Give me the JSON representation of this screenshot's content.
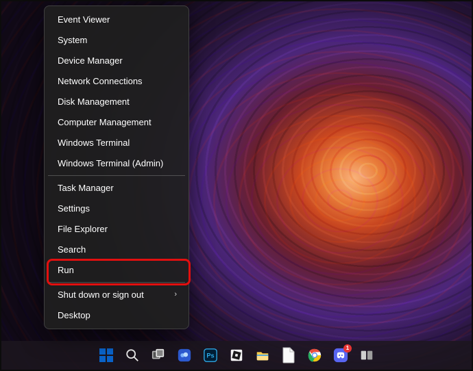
{
  "menu": {
    "groups": [
      {
        "items": [
          {
            "label": "Event Viewer",
            "name": "menu-event-viewer"
          },
          {
            "label": "System",
            "name": "menu-system"
          },
          {
            "label": "Device Manager",
            "name": "menu-device-manager"
          },
          {
            "label": "Network Connections",
            "name": "menu-network-connections"
          },
          {
            "label": "Disk Management",
            "name": "menu-disk-management"
          },
          {
            "label": "Computer Management",
            "name": "menu-computer-management"
          },
          {
            "label": "Windows Terminal",
            "name": "menu-windows-terminal"
          },
          {
            "label": "Windows Terminal (Admin)",
            "name": "menu-windows-terminal-admin"
          }
        ]
      },
      {
        "items": [
          {
            "label": "Task Manager",
            "name": "menu-task-manager"
          },
          {
            "label": "Settings",
            "name": "menu-settings"
          },
          {
            "label": "File Explorer",
            "name": "menu-file-explorer"
          },
          {
            "label": "Search",
            "name": "menu-search"
          },
          {
            "label": "Run",
            "name": "menu-run",
            "highlighted": true
          }
        ]
      },
      {
        "items": [
          {
            "label": "Shut down or sign out",
            "name": "menu-shutdown-signout",
            "submenu": true
          },
          {
            "label": "Desktop",
            "name": "menu-desktop"
          }
        ]
      }
    ]
  },
  "taskbar": {
    "items": [
      {
        "name": "start-button",
        "title": "Start"
      },
      {
        "name": "search-button",
        "title": "Search"
      },
      {
        "name": "task-view-button",
        "title": "Task View"
      },
      {
        "name": "widgets-button",
        "title": "Widgets"
      },
      {
        "name": "photoshop-icon",
        "title": "Adobe Photoshop"
      },
      {
        "name": "roblox-icon",
        "title": "Roblox"
      },
      {
        "name": "file-explorer-icon",
        "title": "File Explorer"
      },
      {
        "name": "document-icon",
        "title": "Document"
      },
      {
        "name": "chrome-icon",
        "title": "Google Chrome"
      },
      {
        "name": "discord-icon",
        "title": "Discord",
        "badge": "1"
      },
      {
        "name": "app-icon",
        "title": "Application"
      }
    ]
  },
  "highlight_color": "#e20f0f"
}
